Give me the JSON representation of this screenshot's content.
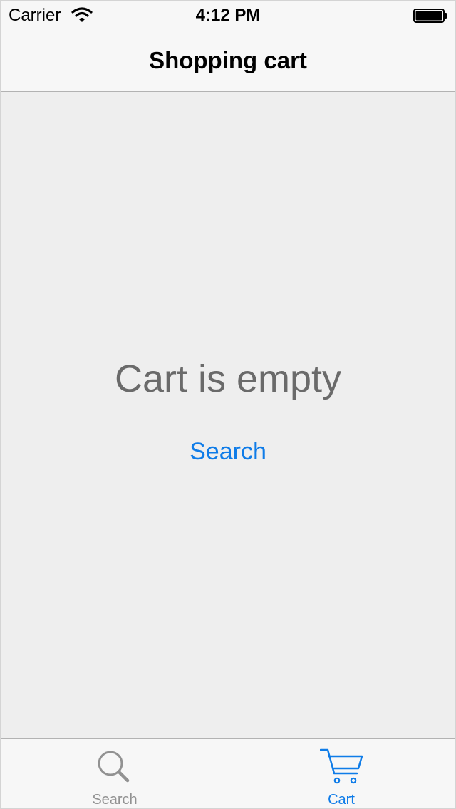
{
  "status_bar": {
    "carrier": "Carrier",
    "time": "4:12 PM",
    "wifi_icon": "wifi-icon",
    "battery_icon": "battery-icon"
  },
  "nav": {
    "title": "Shopping cart"
  },
  "content": {
    "empty_message": "Cart is empty",
    "search_link": "Search"
  },
  "tab_bar": {
    "selected": "Cart",
    "tabs": [
      {
        "label": "Search",
        "icon": "magnifier-icon"
      },
      {
        "label": "Cart",
        "icon": "cart-icon"
      }
    ]
  },
  "colors": {
    "accent": "#0f7ce8",
    "inactive": "#929292",
    "empty_text": "#6a6a6a",
    "background": "#eeeeee",
    "bar_background": "#f7f7f7"
  }
}
